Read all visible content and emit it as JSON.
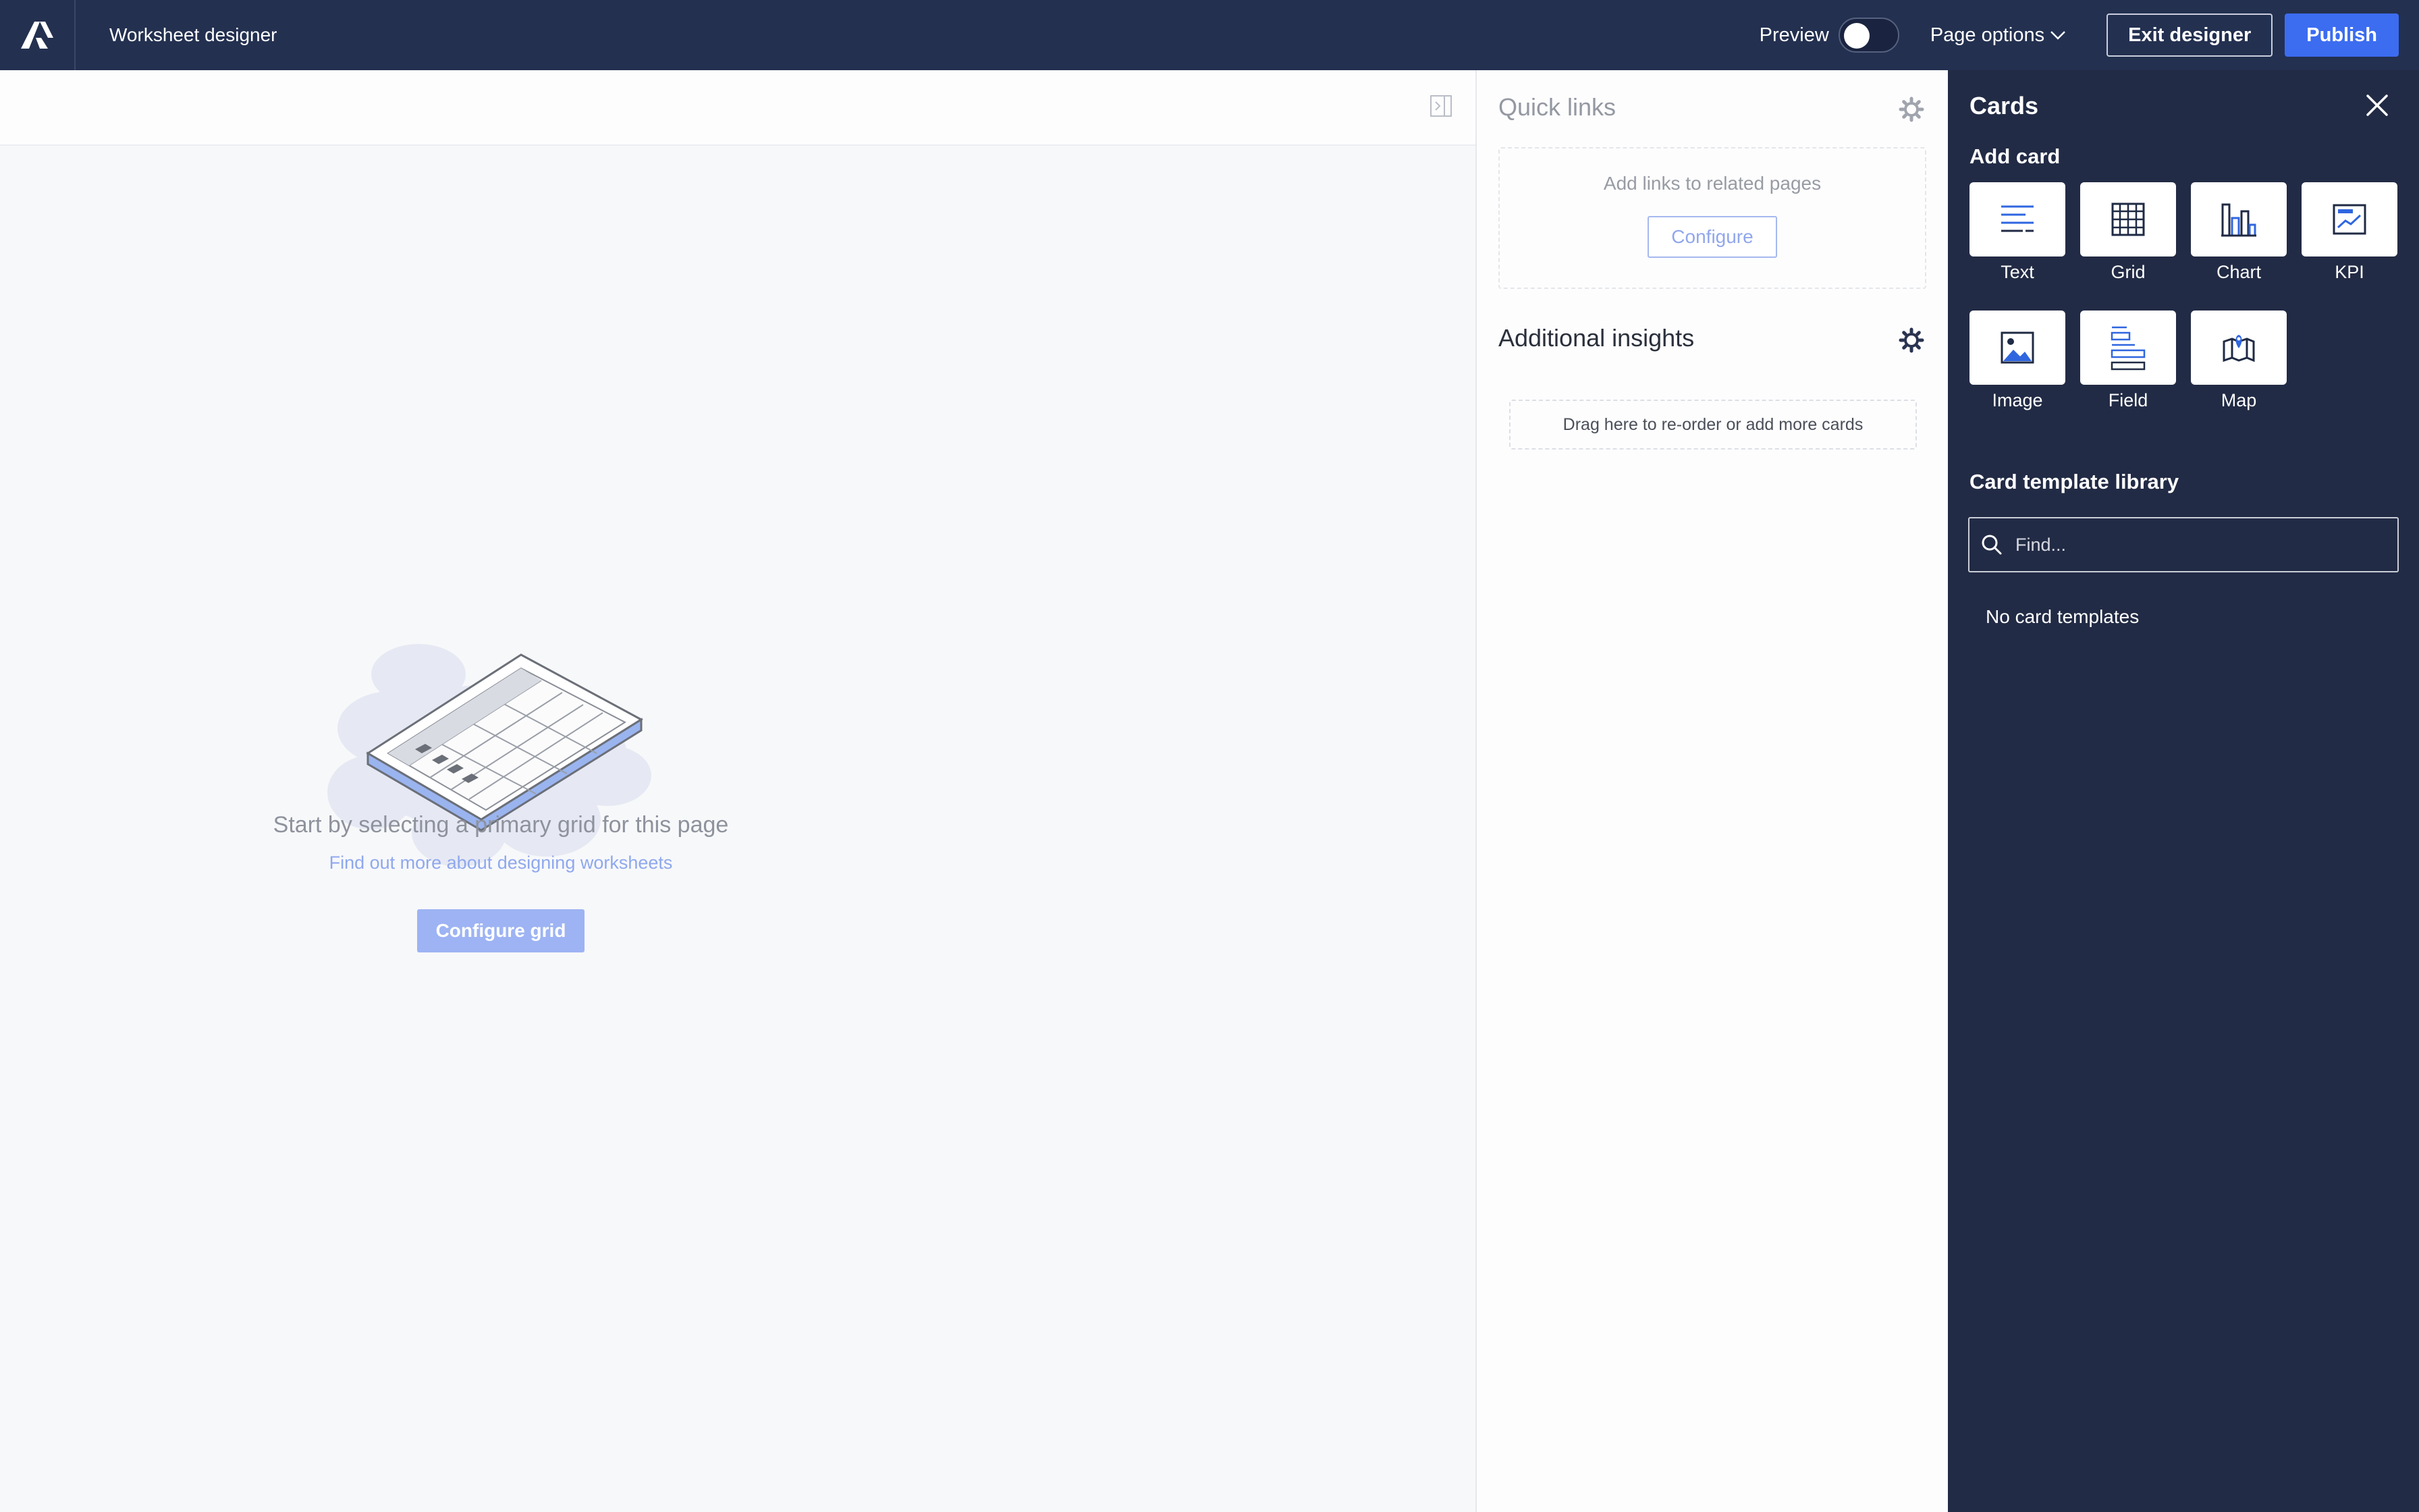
{
  "topbar": {
    "title": "Worksheet designer",
    "preview_label": "Preview",
    "page_options_label": "Page options",
    "exit_label": "Exit designer",
    "publish_label": "Publish"
  },
  "canvas": {
    "empty_title": "Start by selecting a primary grid for this page",
    "empty_link": "Find out more about designing worksheets",
    "configure_grid_label": "Configure grid"
  },
  "insights": {
    "quick_links_title": "Quick links",
    "quick_links_text": "Add links to related pages",
    "configure_label": "Configure",
    "additional_title": "Additional insights",
    "drop_text": "Drag here to re-order or add more cards"
  },
  "cards_panel": {
    "title": "Cards",
    "add_card_title": "Add card",
    "cards": [
      {
        "label": "Text",
        "icon": "text-icon"
      },
      {
        "label": "Grid",
        "icon": "grid-icon"
      },
      {
        "label": "Chart",
        "icon": "chart-icon"
      },
      {
        "label": "KPI",
        "icon": "kpi-icon"
      },
      {
        "label": "Image",
        "icon": "image-icon"
      },
      {
        "label": "Field",
        "icon": "field-icon"
      },
      {
        "label": "Map",
        "icon": "map-icon"
      }
    ],
    "library_title": "Card template library",
    "search_placeholder": "Find...",
    "no_templates": "No card templates"
  },
  "colors": {
    "topbar": "#233050",
    "panel": "#222b45",
    "accent": "#3c6df0"
  }
}
